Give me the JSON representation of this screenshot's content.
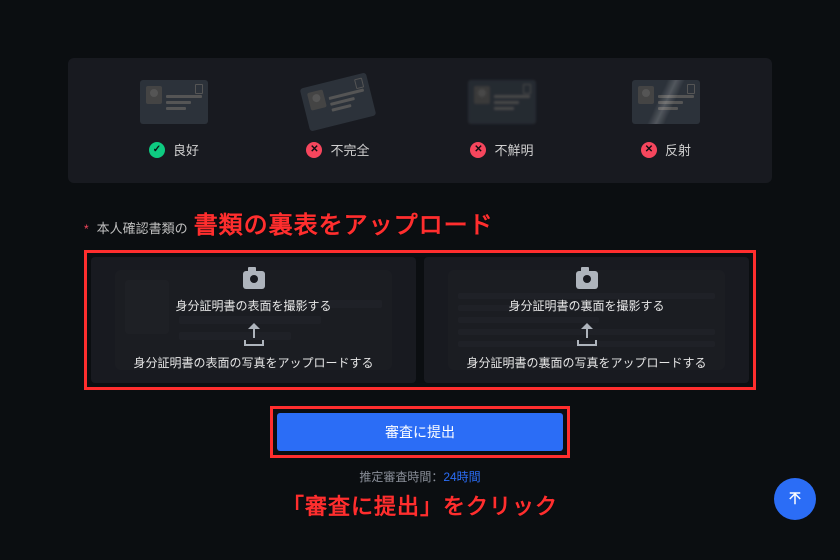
{
  "quality": {
    "good": {
      "label": "良好"
    },
    "incomplete": {
      "label": "不完全"
    },
    "blurry": {
      "label": "不鮮明"
    },
    "glare": {
      "label": "反射"
    }
  },
  "section": {
    "small_label": "本人確認書類の",
    "annotation": "書類の裏表をアップロード"
  },
  "upload": {
    "front": {
      "capture": "身分証明書の表面を撮影する",
      "upload": "身分証明書の表面の写真をアップロードする"
    },
    "back": {
      "capture": "身分証明書の裏面を撮影する",
      "upload": "身分証明書の裏面の写真をアップロードする"
    }
  },
  "submit": {
    "label": "審査に提出"
  },
  "estimate": {
    "label": "推定審査時間：",
    "value": "24時間"
  },
  "bottom_annotation": "「審査に提出」をクリック"
}
